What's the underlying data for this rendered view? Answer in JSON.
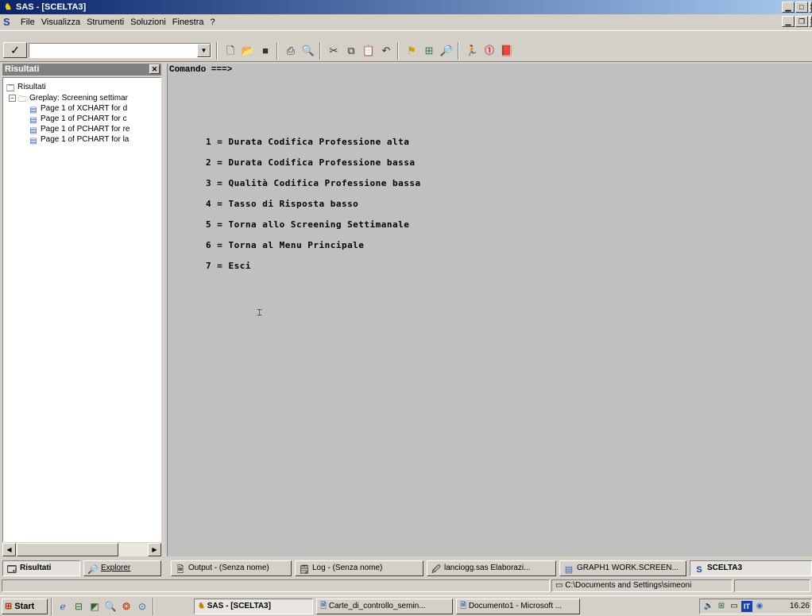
{
  "window": {
    "title": "SAS - [SCELTA3]"
  },
  "menubar": {
    "items": [
      "File",
      "Visualizza",
      "Strumenti",
      "Soluzioni",
      "Finestra",
      "?"
    ]
  },
  "toolbar": {
    "check_label": "✓",
    "command_value": "",
    "icons": [
      "new-icon",
      "open-icon",
      "save-icon",
      "print-icon",
      "print-preview-icon",
      "cut-icon",
      "copy-icon",
      "paste-icon",
      "undo-icon",
      "new-library-icon",
      "explorer-icon",
      "find-icon",
      "submit-icon",
      "break-icon",
      "help-icon"
    ]
  },
  "results_panel": {
    "title": "Risultati",
    "tree": {
      "root": "Risultati",
      "group": "Greplay:  Screening settimar",
      "pages": [
        "Page 1 of XCHART for d",
        "Page 1 of PCHART for c",
        "Page 1 of PCHART for re",
        "Page 1 of PCHART for la"
      ]
    }
  },
  "editor": {
    "command_prompt": "Comando ===>",
    "options": [
      "1 = Durata Codifica Professione alta",
      "2 = Durata Codifica Professione bassa",
      "3 = Qualità Codifica Professione bassa",
      "4 = Tasso di Risposta basso",
      "5 = Torna allo Screening Settimanale",
      "6 = Torna al Menu Principale",
      "7 = Esci"
    ]
  },
  "panel_tabs": {
    "results": "Risultati",
    "explorer": "Explorer"
  },
  "window_bar": {
    "buttons": [
      "Output - (Senza nome)",
      "Log - (Senza nome)",
      "lanciogg.sas   Elaborazi...",
      "GRAPH1  WORK.SCREEN...",
      "SCELTA3"
    ]
  },
  "status_bar": {
    "path": "C:\\Documents and Settings\\simeoni"
  },
  "taskbar": {
    "start": "Start",
    "tasks": [
      "SAS - [SCELTA3]",
      "Carte_di_controllo_semin...",
      "Documento1 - Microsoft ..."
    ],
    "tray_lang": "IT",
    "clock": "16.26"
  }
}
